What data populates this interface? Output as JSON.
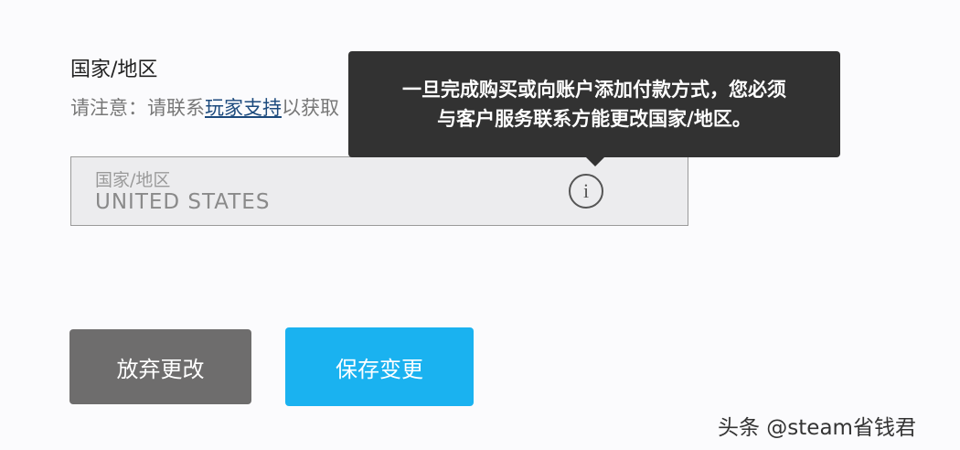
{
  "section": {
    "title": "国家/地区",
    "note_prefix": "请注意：请联系",
    "note_link": "玩家支持",
    "note_suffix": "以获取"
  },
  "field": {
    "label": "国家/地区",
    "value": "UNITED STATES",
    "info_glyph": "i"
  },
  "tooltip": {
    "line1": "一旦完成购买或向账户添加付款方式，您必须",
    "line2": "与客户服务联系方能更改国家/地区。"
  },
  "buttons": {
    "discard": "放弃更改",
    "save": "保存变更"
  },
  "watermark": "头条 @steam省钱君",
  "colors": {
    "tooltip_bg": "#323232",
    "save_button": "#1ab2f0",
    "discard_button": "#6e6d6d",
    "link": "#1c4a7d"
  }
}
